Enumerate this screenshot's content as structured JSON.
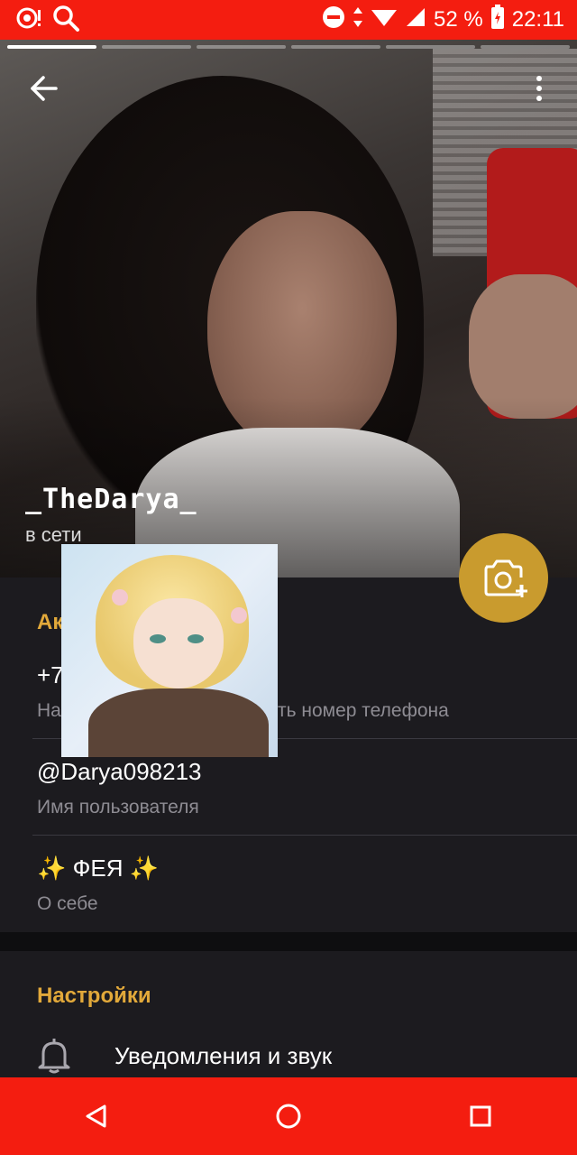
{
  "status_bar": {
    "battery_percent": "52 %",
    "time": "22:11",
    "icons": [
      "notification-icon",
      "search-icon",
      "dnd-icon",
      "data-arrows-icon",
      "wifi-icon",
      "signal-icon",
      "battery-icon"
    ]
  },
  "profile": {
    "name": "_TheDarya_",
    "status": "в сети",
    "story_segments": 6
  },
  "account": {
    "title": "Ак",
    "phone_value": "+7",
    "phone_label_left": "На",
    "phone_label_right": "ть номер телефона",
    "username_value": "@Darya098213",
    "username_label": "Имя пользователя",
    "bio_value": "✨ ФЕЯ ✨",
    "bio_label": "О себе"
  },
  "settings": {
    "title": "Настройки",
    "items": [
      {
        "label": "Уведомления и звук",
        "icon": "bell-icon"
      }
    ]
  },
  "colors": {
    "status_bar": "#f41d10",
    "accent": "#e2a93a",
    "fab": "#c99b2e",
    "background": "#1c1b1f"
  }
}
